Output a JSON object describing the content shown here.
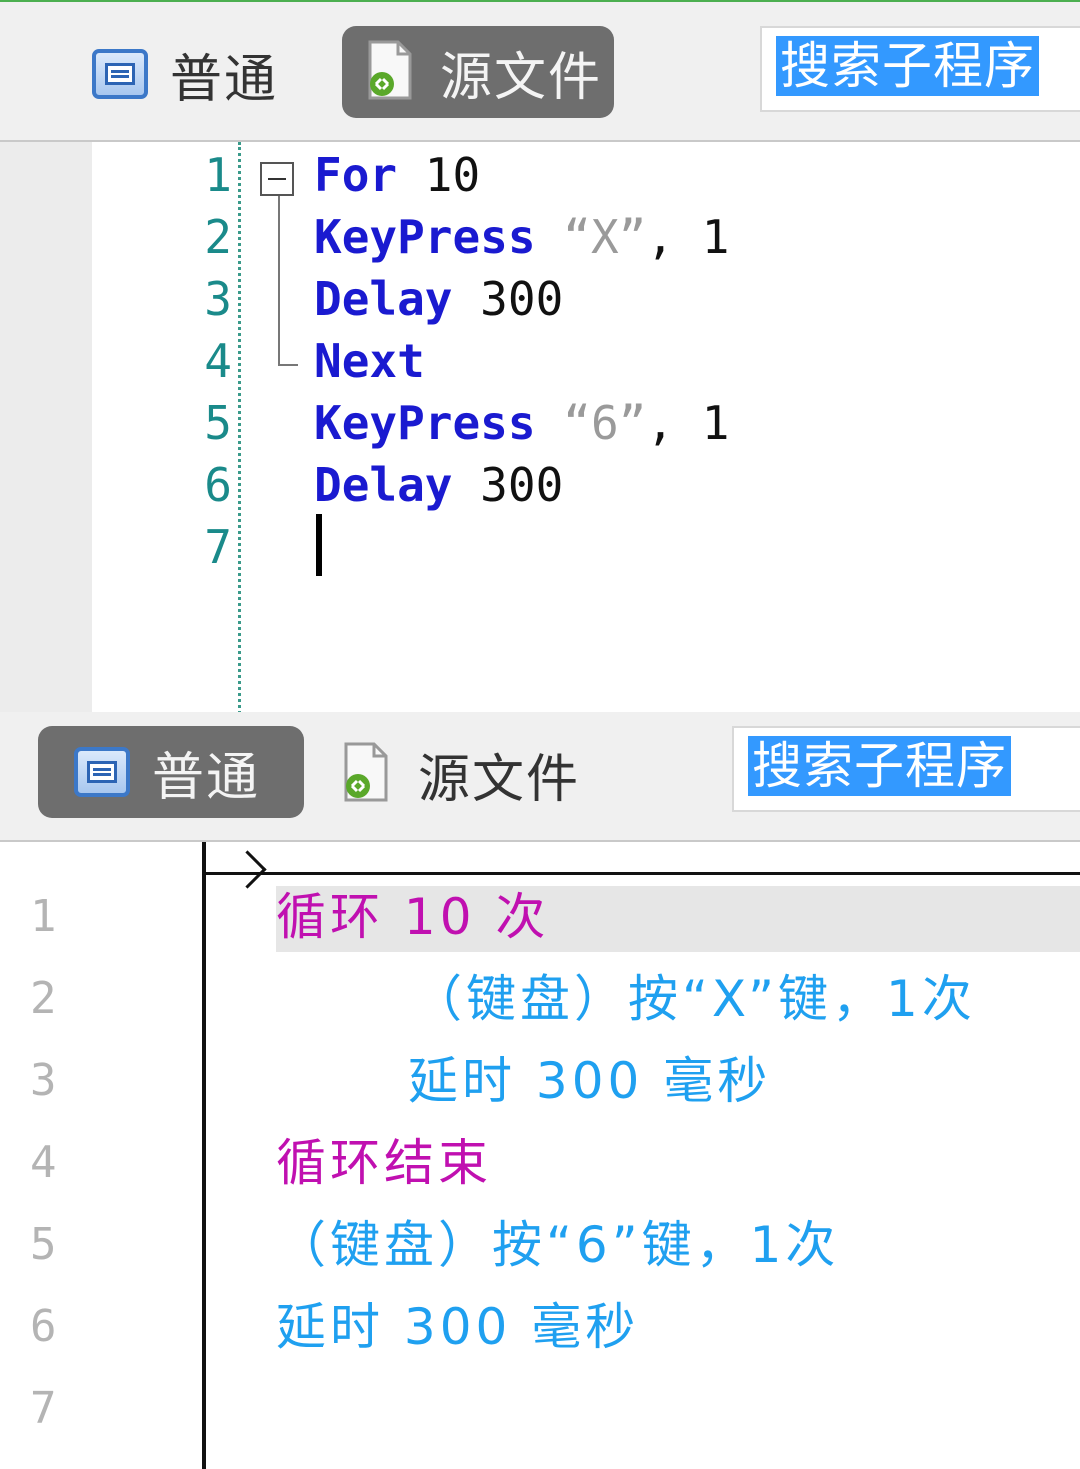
{
  "top_panel": {
    "tabs": [
      {
        "label": "普通",
        "icon": "normal-view-icon",
        "active": false
      },
      {
        "label": "源文件",
        "icon": "source-file-icon",
        "active": true
      }
    ],
    "search_text": "搜索子程序",
    "line_numbers": [
      "1",
      "2",
      "3",
      "4",
      "5",
      "6",
      "7"
    ],
    "code": [
      {
        "kw": "For",
        "rest": " 10"
      },
      {
        "kw": "KeyPress",
        "str": " “X”",
        "rest": ", 1"
      },
      {
        "kw": "Delay",
        "rest": " 300"
      },
      {
        "kw": "Next",
        "rest": ""
      },
      {
        "kw": "KeyPress",
        "str": " “6”",
        "rest": ", 1"
      },
      {
        "kw": "Delay",
        "rest": " 300"
      },
      {
        "kw": "",
        "rest": ""
      }
    ]
  },
  "bottom_panel": {
    "tabs": [
      {
        "label": "普通",
        "icon": "normal-view-icon",
        "active": true
      },
      {
        "label": "源文件",
        "icon": "source-file-icon",
        "active": false
      }
    ],
    "search_text": "搜索子程序",
    "line_numbers": [
      "1",
      "2",
      "3",
      "4",
      "5",
      "6",
      "7"
    ],
    "code": [
      "循环 10 次",
      "（键盘）按“X”键，1次",
      "延时 300 毫秒",
      "循环结束",
      "（键盘）按“6”键，1次",
      "延时 300 毫秒",
      ""
    ]
  },
  "colors": {
    "keyword": "#1a1ad0",
    "loop_text": "#c010b0",
    "action_text": "#1fa0f0",
    "selection": "#3399ff"
  }
}
